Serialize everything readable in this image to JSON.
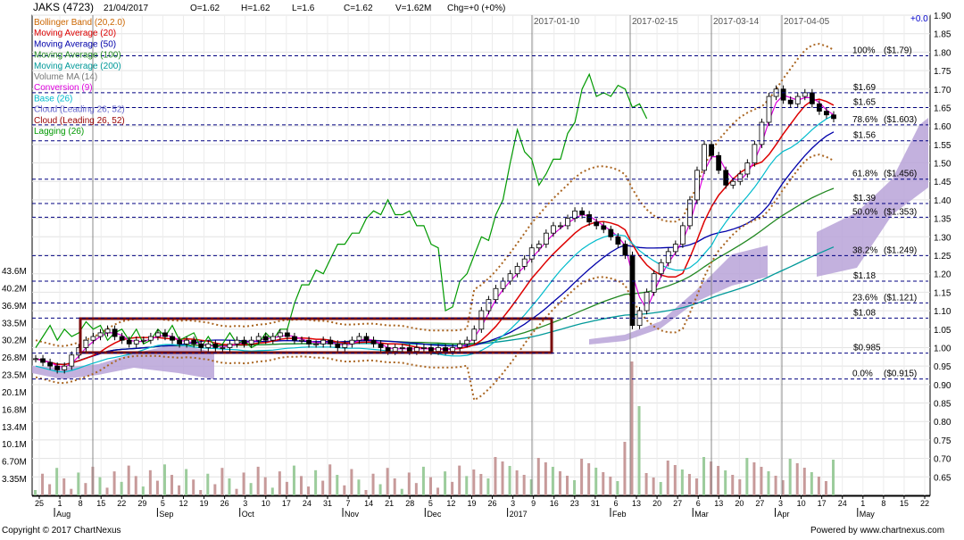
{
  "header": {
    "symbol": "JAKS (4723)",
    "date": "21/04/2017",
    "open": "O=1.62",
    "high": "H=1.62",
    "low": "L=1.6",
    "close": "C=1.62",
    "volume": "V=1.62M",
    "change": "Chg=+0 (+0%)",
    "top_right": "+0.0"
  },
  "legend": [
    {
      "label": "Bollinger Band (20,2.0)",
      "color": "#cc6600"
    },
    {
      "label": "Moving Average (20)",
      "color": "#dd0000"
    },
    {
      "label": "Moving Average (50)",
      "color": "#0000aa"
    },
    {
      "label": "Moving Average (100)",
      "color": "#228822"
    },
    {
      "label": "Moving Average (200)",
      "color": "#009999"
    },
    {
      "label": "Volume MA (14)",
      "color": "#777777"
    },
    {
      "label": "Conversion (9)",
      "color": "#dd00dd"
    },
    {
      "label": "Base (26)",
      "color": "#00bbcc"
    },
    {
      "label": "Cloud (Leading 26, 52)",
      "color": "#6666cc"
    },
    {
      "label": "Cloud (Leading 26, 52)",
      "color": "#990000"
    },
    {
      "label": "Lagging (26)",
      "color": "#009900"
    }
  ],
  "footer": {
    "copyright": "Copyright © 2017 ChartNexus",
    "powered": "Powered by www.chartnexus.com"
  },
  "colors": {
    "up_candle": "#ffffff",
    "down_candle": "#000000",
    "volume_bar": "#c79a9a",
    "volume_bar_up": "#9ccc9c",
    "grid": "#000080",
    "cloud": "#b9a3d8",
    "rectangle": "#7a0a0a"
  },
  "chart_data": {
    "type": "candlestick",
    "title": "JAKS (4723)",
    "ylim": [
      0.6,
      1.9
    ],
    "y_ticks": [
      "1.90",
      "1.85",
      "1.80",
      "1.75",
      "1.70",
      "1.65",
      "1.60",
      "1.55",
      "1.50",
      "1.45",
      "1.40",
      "1.35",
      "1.30",
      "1.25",
      "1.20",
      "1.15",
      "1.10",
      "1.05",
      "1.00",
      "0.95",
      "0.90",
      "0.85",
      "0.80",
      "0.75",
      "0.70",
      "0.65"
    ],
    "volume_ticks": [
      "43.6M",
      "40.2M",
      "36.9M",
      "33.5M",
      "30.2M",
      "26.8M",
      "23.5M",
      "20.1M",
      "16.8M",
      "13.4M",
      "10.1M",
      "6.70M",
      "3.35M"
    ],
    "x_ticks": [
      "25",
      "1",
      "8",
      "15",
      "22",
      "29",
      "5",
      "12",
      "19",
      "26",
      "3",
      "10",
      "17",
      "24",
      "31",
      "7",
      "14",
      "21",
      "28",
      "5",
      "12",
      "19",
      "26",
      "3",
      "9",
      "16",
      "23",
      "31",
      "6",
      "13",
      "20",
      "27",
      "6",
      "13",
      "20",
      "27",
      "3",
      "10",
      "17",
      "24",
      "1",
      "8",
      "15",
      "22"
    ],
    "x_months": [
      "Aug",
      "Sep",
      "Oct",
      "Nov",
      "Dec",
      "2017",
      "Feb",
      "Mar",
      "Apr",
      "May"
    ],
    "marker_dates": [
      "2017-01-10",
      "2017-02-15",
      "2017-03-14",
      "2017-04-05"
    ],
    "fibonacci": [
      {
        "label": "100%",
        "price": "($1.79)",
        "value": 1.79
      },
      {
        "label": "78.6%",
        "price": "($1.603)",
        "value": 1.603
      },
      {
        "label": "61.8%",
        "price": "($1.456)",
        "value": 1.456
      },
      {
        "label": "50.0%",
        "price": "($1.353)",
        "value": 1.353
      },
      {
        "label": "38.2%",
        "price": "($1.249)",
        "value": 1.249
      },
      {
        "label": "23.6%",
        "price": "($1.121)",
        "value": 1.121
      },
      {
        "label": "0.0%",
        "price": "($0.915)",
        "value": 0.915
      }
    ],
    "levels": [
      {
        "label": "$1.69",
        "value": 1.69
      },
      {
        "label": "$1.65",
        "value": 1.65
      },
      {
        "label": "$1.56",
        "value": 1.56
      },
      {
        "label": "$1.39",
        "value": 1.39
      },
      {
        "label": "$1.18",
        "value": 1.18
      },
      {
        "label": "$1.08",
        "value": 1.08
      },
      {
        "label": "$0.985",
        "value": 0.985
      }
    ],
    "close_series": [
      0.97,
      0.96,
      0.95,
      0.94,
      0.95,
      0.98,
      1.0,
      1.02,
      1.03,
      1.04,
      1.05,
      1.03,
      1.02,
      1.01,
      1.02,
      1.02,
      1.03,
      1.04,
      1.03,
      1.02,
      1.01,
      1.02,
      1.01,
      1.0,
      1.01,
      1.0,
      1.0,
      1.01,
      1.02,
      1.01,
      1.02,
      1.03,
      1.02,
      1.03,
      1.04,
      1.03,
      1.02,
      1.02,
      1.01,
      1.01,
      1.02,
      1.01,
      1.0,
      1.01,
      1.02,
      1.03,
      1.02,
      1.01,
      1.0,
      0.99,
      1.0,
      1.0,
      0.99,
      1.0,
      1.0,
      0.99,
      1.0,
      0.99,
      1.0,
      1.01,
      1.02,
      1.05,
      1.1,
      1.13,
      1.16,
      1.18,
      1.2,
      1.22,
      1.24,
      1.27,
      1.28,
      1.31,
      1.33,
      1.33,
      1.35,
      1.37,
      1.36,
      1.34,
      1.33,
      1.32,
      1.3,
      1.28,
      1.25,
      1.06,
      1.1,
      1.15,
      1.2,
      1.23,
      1.26,
      1.28,
      1.33,
      1.4,
      1.48,
      1.55,
      1.52,
      1.48,
      1.44,
      1.45,
      1.47,
      1.5,
      1.55,
      1.61,
      1.68,
      1.7,
      1.67,
      1.66,
      1.68,
      1.69,
      1.66,
      1.64,
      1.63,
      1.62
    ]
  }
}
